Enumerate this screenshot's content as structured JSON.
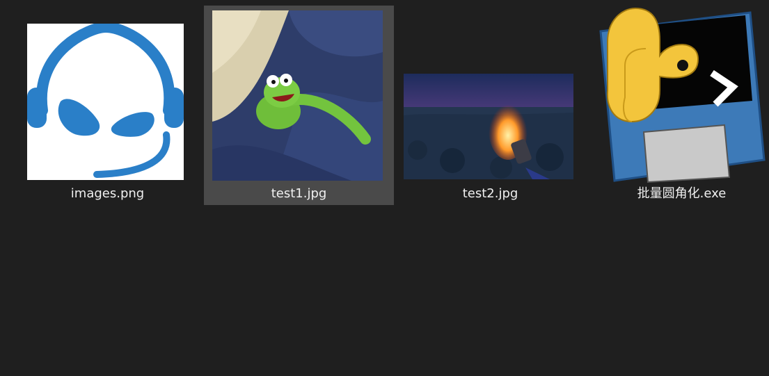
{
  "files": [
    {
      "name": "images.png",
      "icon": "teamviewer-headset-icon",
      "selected": false
    },
    {
      "name": "test1.jpg",
      "icon": "kermit-photo-thumbnail",
      "selected": true
    },
    {
      "name": "test2.jpg",
      "icon": "desert-sunset-gun-thumbnail",
      "selected": false
    },
    {
      "name": "批量圆角化.exe",
      "icon": "python-floppy-icon",
      "selected": false
    }
  ],
  "colors": {
    "background": "#1f1f1f",
    "selection": "#4a4a4a",
    "label_text": "#f0f0f0",
    "brand_blue": "#2a7fc8"
  }
}
